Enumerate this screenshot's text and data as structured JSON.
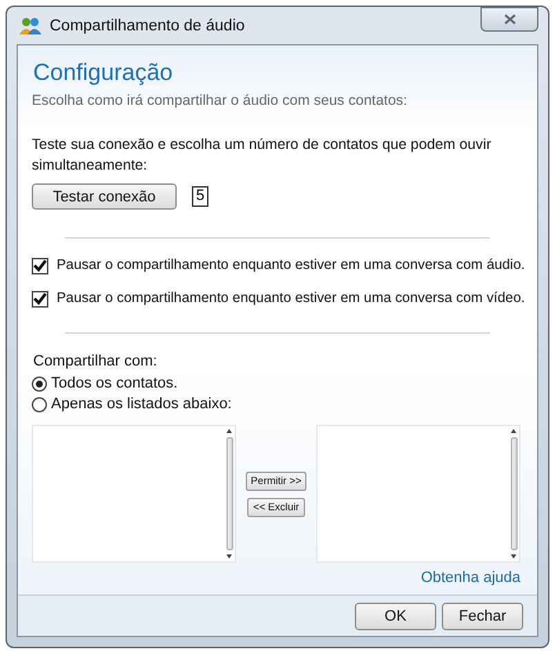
{
  "window": {
    "title": "Compartilhamento de áudio"
  },
  "heading": "Configuração",
  "subtitle": "Escolha como irá compartilhar o áudio com seus contatos:",
  "test": {
    "text": "Teste sua conexão e escolha um número de contatos que podem ouvir simultaneamente:",
    "button": "Testar conexão",
    "count": "5"
  },
  "options": [
    {
      "label": "Pausar o compartilhamento enquanto estiver em uma conversa com áudio.",
      "checked": true
    },
    {
      "label": "Pausar o compartilhamento enquanto estiver em uma conversa com vídeo.",
      "checked": true
    }
  ],
  "share": {
    "label": "Compartilhar com:",
    "choices": [
      {
        "label": "Todos os contatos.",
        "selected": true
      },
      {
        "label": "Apenas os listados abaixo:",
        "selected": false
      }
    ]
  },
  "transfer": {
    "allow": "Permitir >>",
    "exclude": "<< Excluir"
  },
  "help_link": "Obtenha ajuda",
  "buttons": [
    "OK",
    "Fechar"
  ]
}
